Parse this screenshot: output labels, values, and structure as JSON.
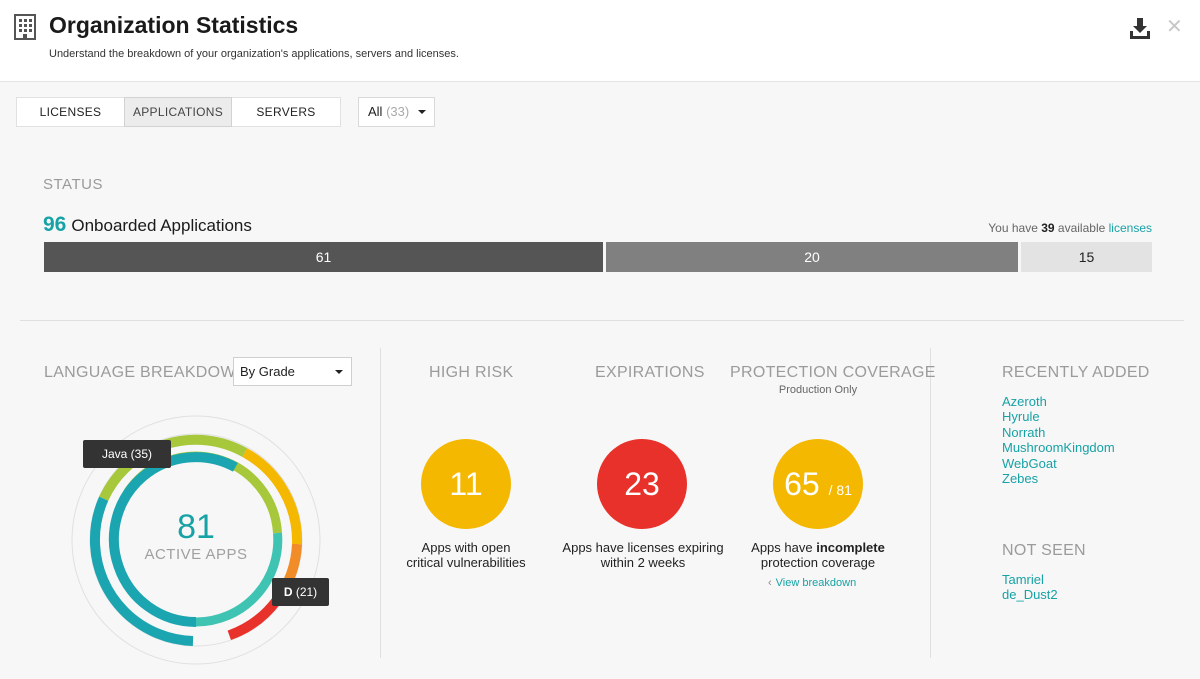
{
  "header": {
    "title": "Organization Statistics",
    "subtitle": "Understand the breakdown of your organization's applications, servers and licenses."
  },
  "tabs": [
    "LICENSES",
    "APPLICATIONS",
    "SERVERS"
  ],
  "filter": {
    "label": "All",
    "count": "(33)"
  },
  "status": {
    "title": "STATUS",
    "count": "96",
    "label": "Onboarded Applications",
    "available_prefix": "You have",
    "available_count": "39",
    "available_mid": "available",
    "available_link": "licenses",
    "bars": [
      "61",
      "20",
      "15"
    ]
  },
  "language": {
    "title": "LANGUAGE BREAKDOWN",
    "select": "By Grade",
    "center_number": "81",
    "center_label": "ACTIVE APPS",
    "tooltip_java": "Java (35)",
    "tooltip_grade": "D",
    "tooltip_grade_count": "(21)"
  },
  "high_risk": {
    "title": "HIGH RISK",
    "value": "11",
    "caption_line1": "Apps with open",
    "caption_line2": "critical vulnerabilities"
  },
  "expirations": {
    "title": "EXPIRATIONS",
    "value": "23",
    "caption_line1": "Apps have licenses expiring",
    "caption_line2": "within 2 weeks"
  },
  "coverage": {
    "title": "PROTECTION COVERAGE",
    "subtitle": "Production Only",
    "value": "65",
    "denominator": "/ 81",
    "caption_pre": "Apps have",
    "caption_bold": "incomplete",
    "caption_line2": "protection coverage",
    "link": "View breakdown"
  },
  "recently_added": {
    "title": "RECENTLY ADDED",
    "items": [
      "Azeroth",
      "Hyrule",
      "Norrath",
      "MushroomKingdom",
      "WebGoat",
      "Zebes"
    ]
  },
  "not_seen": {
    "title": "NOT SEEN",
    "items": [
      "Tamriel",
      "de_Dust2"
    ]
  },
  "colors": {
    "accent": "#17a2a6",
    "yellow": "#f5b800",
    "red": "#e8312a",
    "orange": "#f28c28",
    "green": "#a6c83a",
    "teal_light": "#3fc4b3"
  }
}
